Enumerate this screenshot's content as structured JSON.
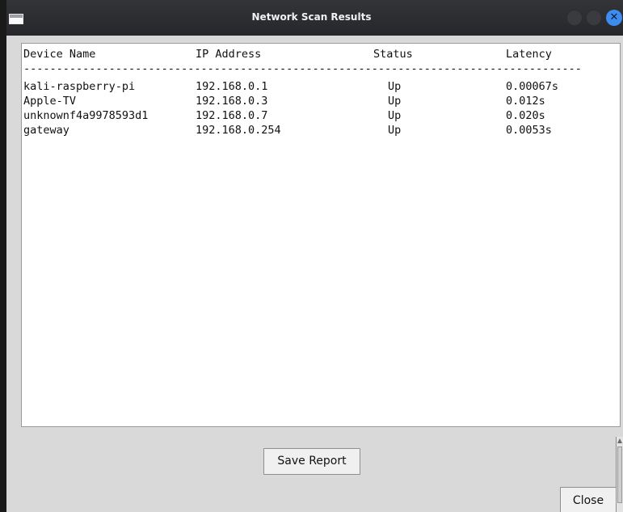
{
  "window": {
    "title": "Network Scan Results"
  },
  "titlebar_buttons": {
    "minimize_icon": "circle",
    "maximize_icon": "circle",
    "close_glyph": "✕",
    "close_color": "#3d8cf0"
  },
  "table": {
    "columns": [
      "Device Name",
      "IP Address",
      "Status",
      "Latency"
    ],
    "separator": "------------------------------------------------------------------------------------------",
    "rows": [
      {
        "device": "kali-raspberry-pi",
        "ip": "192.168.0.1",
        "status": "Up",
        "latency": "0.00067s"
      },
      {
        "device": "Apple-TV",
        "ip": "192.168.0.3",
        "status": "Up",
        "latency": "0.012s"
      },
      {
        "device": "unknownf4a9978593d1",
        "ip": "192.168.0.7",
        "status": "Up",
        "latency": "0.020s"
      },
      {
        "device": "gateway",
        "ip": "192.168.0.254",
        "status": "Up",
        "latency": "0.0053s"
      }
    ]
  },
  "buttons": {
    "save_label": "Save Report",
    "close_label": "Close"
  }
}
